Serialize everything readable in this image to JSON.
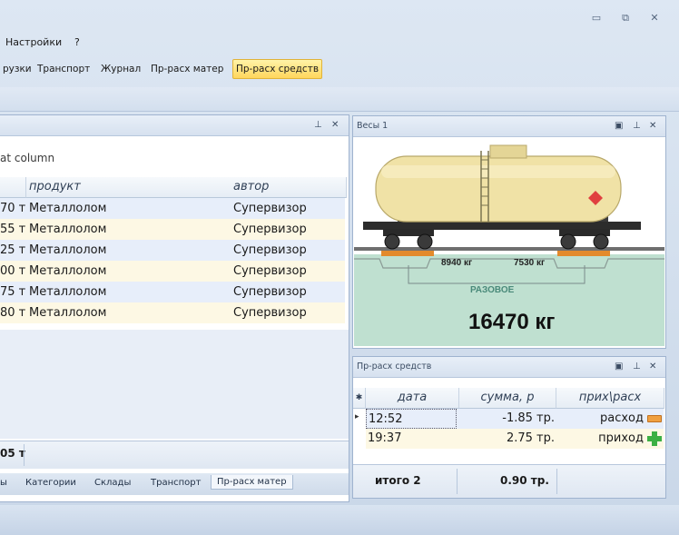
{
  "window": {
    "btn_min": "▭",
    "btn_restore": "⧉",
    "btn_close": "✕"
  },
  "menu": {
    "settings": "Настройки",
    "help": "?"
  },
  "ribbon": {
    "tabs": [
      {
        "label": "рузки"
      },
      {
        "label": "Транспорт"
      },
      {
        "label": "Журнал"
      },
      {
        "label": "Пр-расх матер"
      },
      {
        "label": "Пр-расх средств",
        "active": true
      }
    ]
  },
  "left_panel": {
    "group_hint": "at column",
    "columns": [
      "продукт",
      "автор"
    ],
    "rows": [
      {
        "amount": "70 т",
        "product": "Металлолом",
        "author": "Супервизор"
      },
      {
        "amount": "55 т",
        "product": "Металлолом",
        "author": "Супервизор"
      },
      {
        "amount": "25 т",
        "product": "Металлолом",
        "author": "Супервизор"
      },
      {
        "amount": "00 т",
        "product": "Металлолом",
        "author": "Супервизор"
      },
      {
        "amount": "75 т",
        "product": "Металлолом",
        "author": "Супервизор"
      },
      {
        "amount": "80 т",
        "product": "Металлолом",
        "author": "Супервизор"
      }
    ],
    "footer_total": "05 т",
    "bottom_tabs": [
      "ы",
      "Категории",
      "Склады",
      "Транспорт",
      "Пр-расх матер"
    ]
  },
  "scale_panel": {
    "title": "Весы 1",
    "weight_left": "8940 кг",
    "weight_right": "7530 кг",
    "mode": "РАЗОВОЕ",
    "total": "16470 кг"
  },
  "cash_panel": {
    "title": "Пр-расх средств",
    "columns": [
      "дата",
      "сумма, р",
      "прих\\расх"
    ],
    "rows": [
      {
        "date": "12:52",
        "sum": "-1.85 тр.",
        "type": "расход",
        "icon": "minus-icon",
        "icon_color": "#f0a040"
      },
      {
        "date": "19:37",
        "sum": "2.75 тр.",
        "type": "приход",
        "icon": "plus-icon",
        "icon_color": "#3cb043"
      }
    ],
    "footer_label": "итого 2",
    "footer_sum": "0.90 тр."
  },
  "colors": {
    "accent_tab": "#ffd65c",
    "scale_ground": "#bfe0d0",
    "tank_body": "#f0e2a6"
  }
}
